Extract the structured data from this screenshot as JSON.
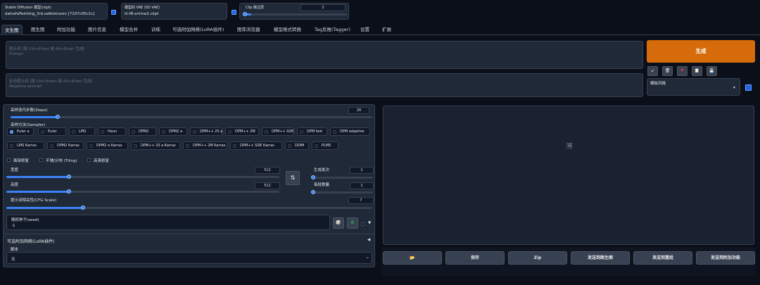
{
  "topbar": {
    "checkpoint_label": "Stable Diffusion 模型(ckpt)",
    "checkpoint_value": "dalcefoPainting_3rd.safetensors [7107c05c1c]",
    "vae_label": "模型的 VAE (SD VAE)",
    "vae_value": "kl-f8-anime2.ckpt",
    "clip_label": "Clip 跳过层",
    "clip_value": "2"
  },
  "tabs": [
    "文生图",
    "图生图",
    "附加功能",
    "图片信息",
    "模型合并",
    "训练",
    "可选附加网络(LoRA插件)",
    "图库浏览器",
    "模型格式转换",
    "Tag反推(Tagger)",
    "设置",
    "扩展"
  ],
  "prompt": {
    "label": "提示词 (按 Ctrl+Enter 或 Alt+Enter 生成)",
    "placeholder": "Prompt",
    "neg_label": "反向提示词 (按 Ctrl+Enter 或 Alt+Enter 生成)",
    "neg_placeholder": "Negative prompt"
  },
  "generate_label": "生成",
  "style": {
    "label": "模板风格"
  },
  "tool_buttons": {
    "arrow": "↙",
    "trash": "🗑",
    "flag": "⚑",
    "clipboard": "📋",
    "save": "💾"
  },
  "steps": {
    "label": "采样迭代步数(Steps)",
    "value": "20",
    "fraction": 0.13
  },
  "sampler": {
    "label": "采样方法(Sampler)",
    "options": [
      "Euler a",
      "Euler",
      "LMS",
      "Heun",
      "DPM2",
      "DPM2 a",
      "DPM++ 2S a",
      "DPM++ 2M",
      "DPM++ SDE",
      "DPM fast",
      "DPM adaptive",
      "LMS Karras",
      "DPM2 Karras",
      "DPM2 a Karras",
      "DPM++ 2S a Karras",
      "DPM++ 2M Karras",
      "DPM++ SDE Karras",
      "DDIM",
      "PLMS"
    ],
    "selected": "Euler a"
  },
  "checks": {
    "restore_faces": "面部修复",
    "tiling": "平铺/分块 (Tiling)",
    "hires_fix": "高清修复"
  },
  "width": {
    "label": "宽度",
    "value": "512",
    "fraction": 0.23
  },
  "height": {
    "label": "高度",
    "value": "512",
    "fraction": 0.23
  },
  "swap_icon": "⇅",
  "batch_count": {
    "label": "生成批次",
    "value": "1",
    "fraction": 0.0
  },
  "batch_size": {
    "label": "每批数量",
    "value": "1",
    "fraction": 0.0
  },
  "cfg": {
    "label": "提示词相关性(CFG Scale)",
    "value": "7",
    "fraction": 0.21
  },
  "seed": {
    "label": "随机种子(seed)",
    "value": "-1",
    "dice_icon": "🎲",
    "recycle_icon": "♻",
    "expand_icon": "▼"
  },
  "lora": {
    "label": "可选附加网络(LoRA插件)",
    "collapse_icon": "◀"
  },
  "script": {
    "label": "脚本",
    "value": "无"
  },
  "output": {
    "image_icon": "🖼",
    "buttons": [
      "📂",
      "保存",
      "Zip",
      "发送到图生图",
      "发送到重绘",
      "发送到附加功能"
    ]
  },
  "colors": {
    "accent": "#d66b0b",
    "blue": "#3b82f6",
    "bg": "#0b0f19",
    "panel": "#1f2937"
  }
}
